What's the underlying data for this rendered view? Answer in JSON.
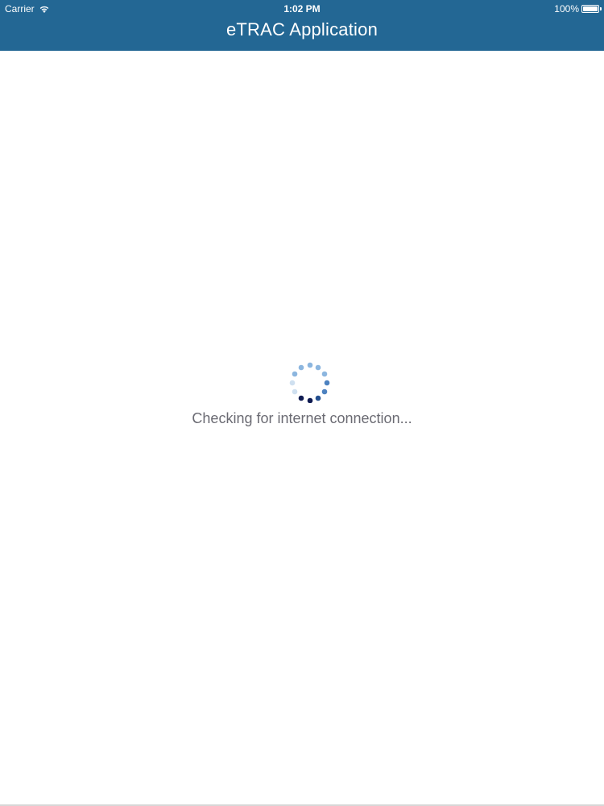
{
  "status_bar": {
    "carrier": "Carrier",
    "wifi_icon": "wifi-icon",
    "time": "1:02 PM",
    "battery_percent": "100%",
    "battery_level": 1.0,
    "battery_icon": "battery-icon"
  },
  "header": {
    "title": "eTRAC Application",
    "background_color": "#236794",
    "text_color": "#ffffff"
  },
  "loading": {
    "spinner_icon": "loading-spinner-icon",
    "message": "Checking for internet connection...",
    "text_color": "#6b6b73",
    "spinner_colors": [
      "#0f1b52",
      "#244f8f",
      "#4d82c0",
      "#8cb6df",
      "#cfe0f0"
    ]
  }
}
